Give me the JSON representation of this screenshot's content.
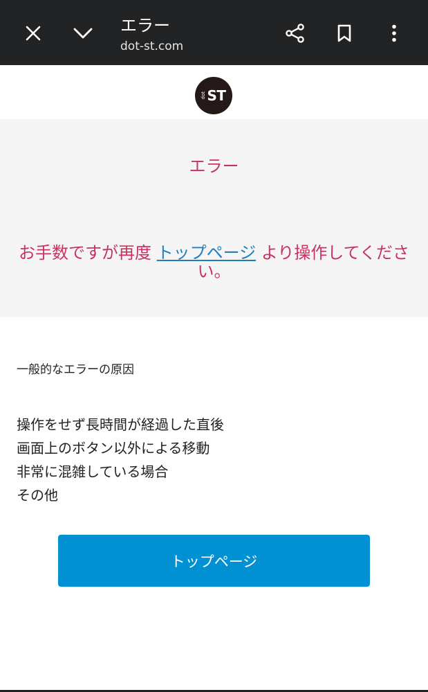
{
  "browser": {
    "title": "エラー",
    "url": "dot-st.com",
    "icons": [
      "close-icon",
      "chevron-down-icon",
      "share-icon",
      "bookmark-icon",
      "more-vert-icon"
    ]
  },
  "logo": {
    "small": "dot",
    "big": "ST"
  },
  "error": {
    "title": "エラー",
    "message_before": "お手数ですが再度 ",
    "message_link": "トップページ",
    "message_after": " より操作してください。"
  },
  "causes": {
    "heading": "一般的なエラーの原因",
    "items": [
      "操作をせず長時間が経過した直後",
      "画面上のボタン以外による移動",
      "非常に混雑している場合",
      "その他"
    ]
  },
  "button": {
    "label": "トップページ"
  },
  "colors": {
    "bar": "#212325",
    "accent": "#0191d2",
    "error": "#c9335f",
    "band": "#f5f5f5",
    "link": "#1f7fc1"
  }
}
